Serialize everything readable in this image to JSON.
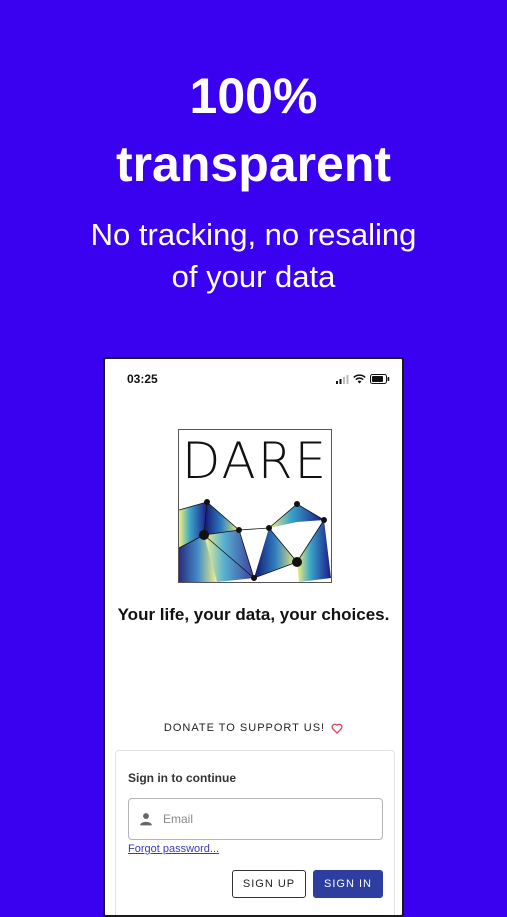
{
  "promo": {
    "headline_line1": "100%",
    "headline_line2": "transparent",
    "subline_line1": "No tracking, no resaling",
    "subline_line2": "of your data"
  },
  "phone": {
    "status_bar": {
      "time": "03:25",
      "icons": [
        "signal-icon",
        "wifi-icon",
        "battery-icon"
      ]
    },
    "logo": {
      "text": "DARE"
    },
    "tagline": "Your life, your data, your choices.",
    "donate": {
      "label": "DONATE TO SUPPORT US!",
      "icon": "heart-icon"
    },
    "signin": {
      "title": "Sign in to continue",
      "email_placeholder": "Email",
      "email_value": "",
      "forgot_label": "Forgot password...",
      "signup_label": "SIGN UP",
      "signin_label": "SIGN IN"
    }
  },
  "colors": {
    "background": "#3a00f0",
    "primary_button": "#2d3ea0",
    "heart": "#e0405a",
    "link": "#3a3ac0"
  }
}
